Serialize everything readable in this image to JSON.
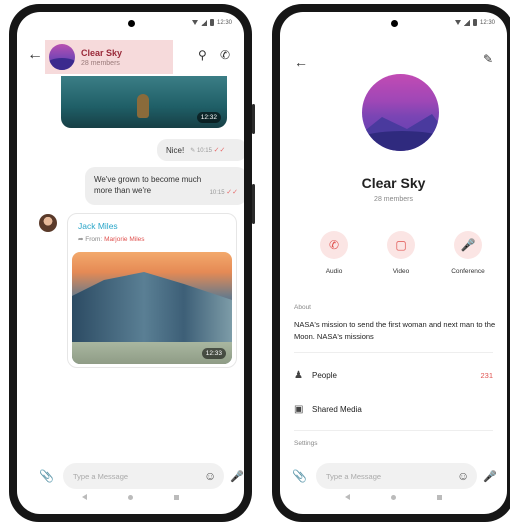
{
  "colors": {
    "accent": "#e0524f",
    "link": "#2aa6c9",
    "header_highlight": "#f6dadb"
  },
  "status": {
    "time": "12:30"
  },
  "chat": {
    "title": "Clear Sky",
    "members": "28 members",
    "images": [
      {
        "time": "12:32"
      },
      {
        "time": "12:33"
      }
    ],
    "messages": [
      {
        "text": "Nice!",
        "time": "10:15"
      },
      {
        "text": "We've grown to become much more than we're",
        "time": "10:15"
      }
    ],
    "forward": {
      "sender": "Jack Miles",
      "from_label": "From:",
      "from_name": "Marjorie Miles"
    },
    "composer": {
      "placeholder": "Type a Message"
    }
  },
  "profile": {
    "title": "Clear Sky",
    "members": "28 members",
    "actions": [
      {
        "label": "Audio",
        "icon": "phone-icon"
      },
      {
        "label": "Video",
        "icon": "video-icon"
      },
      {
        "label": "Conference",
        "icon": "microphone-icon"
      }
    ],
    "about_label": "About",
    "about_text": "NASA's mission to send the first woman and next man to the Moon. NASA's missions",
    "rows": [
      {
        "label": "People",
        "count": "231",
        "icon": "people-icon"
      },
      {
        "label": "Shared Media",
        "icon": "media-icon"
      }
    ],
    "settings_label": "Settings",
    "composer": {
      "placeholder": "Type a Message"
    }
  }
}
